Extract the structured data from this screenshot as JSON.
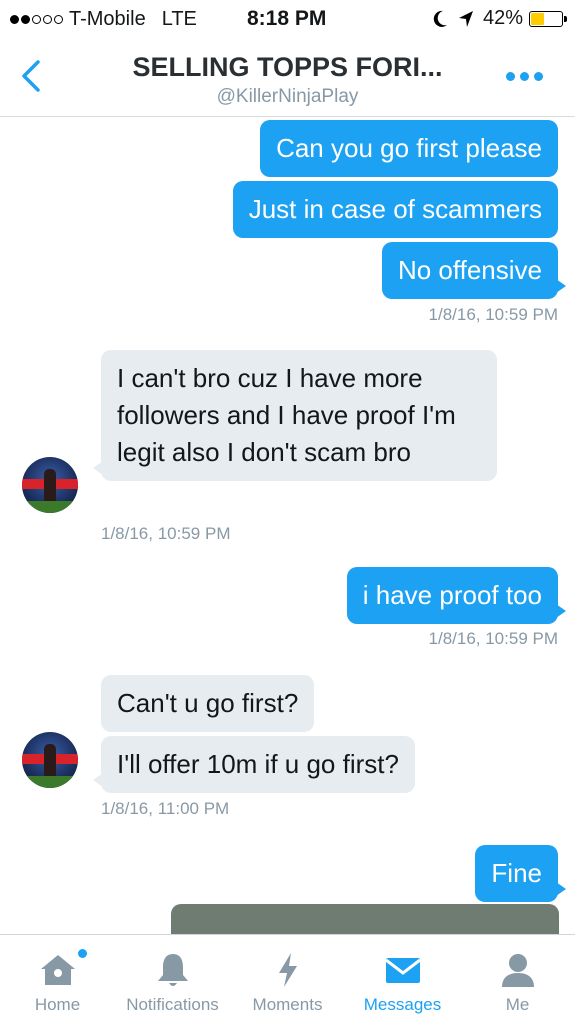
{
  "status_bar": {
    "carrier": "T-Mobile",
    "network": "LTE",
    "time": "8:18 PM",
    "battery": "42%",
    "battery_level": 0.42
  },
  "header": {
    "title": "SELLING TOPPS FORI...",
    "handle": "@KillerNinjaPlay"
  },
  "messages": [
    {
      "from": "me",
      "text": "Can you go first please"
    },
    {
      "from": "me",
      "text": "Just in case of scammers"
    },
    {
      "from": "me",
      "text": "No offensive",
      "time": "1/8/16, 10:59 PM"
    },
    {
      "from": "them",
      "text": "I can't bro cuz I have more followers and I have proof I'm legit also I don't scam bro",
      "time": "1/8/16, 10:59 PM"
    },
    {
      "from": "me",
      "text": "i have proof too",
      "time": "1/8/16, 10:59 PM"
    },
    {
      "from": "them",
      "text": "Can't u go first?"
    },
    {
      "from": "them",
      "text": "I'll offer 10m if u go first?",
      "time": "1/8/16, 11:00 PM"
    },
    {
      "from": "me",
      "text": "Fine"
    }
  ],
  "tabs": [
    {
      "label": "Home",
      "icon": "home-icon"
    },
    {
      "label": "Notifications",
      "icon": "bell-icon"
    },
    {
      "label": "Moments",
      "icon": "lightning-icon"
    },
    {
      "label": "Messages",
      "icon": "envelope-icon",
      "active": true
    },
    {
      "label": "Me",
      "icon": "person-icon"
    }
  ],
  "colors": {
    "accent": "#1da1f2",
    "incoming_bubble": "#e6ecf0",
    "muted_text": "#8899a6"
  }
}
